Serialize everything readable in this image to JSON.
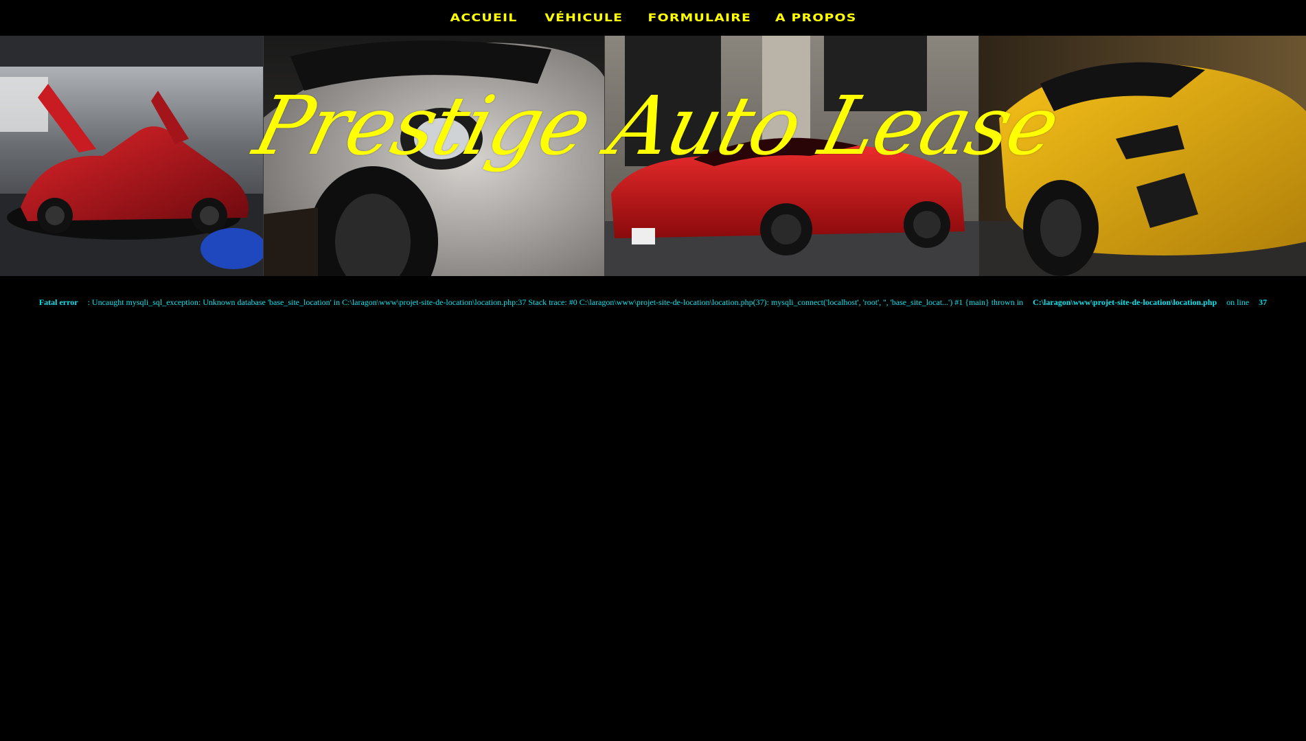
{
  "nav": {
    "items": [
      {
        "label": "ACCUEIL"
      },
      {
        "label": "VÉHICULE"
      },
      {
        "label": "FORMULAIRE"
      },
      {
        "label": "A PROPOS"
      }
    ]
  },
  "banner": {
    "title": "Prestige Auto Lease",
    "photos": [
      {
        "description": "red-supercar-doors-open"
      },
      {
        "description": "white-sports-car-closeup"
      },
      {
        "description": "red-grand-tourer-street"
      },
      {
        "description": "yellow-supercar-front"
      }
    ]
  },
  "error": {
    "label": "Fatal error",
    "message": ": Uncaught mysqli_sql_exception: Unknown database 'base_site_location' in C:\\laragon\\www\\projet-site-de-location\\location.php:37 Stack trace: #0 C:\\laragon\\www\\projet-site-de-location\\location.php(37): mysqli_connect('localhost', 'root', '', 'base_site_locat...') #1 {main} thrown in",
    "file": "C:\\laragon\\www\\projet-site-de-location\\location.php",
    "on_line_text": "on line",
    "line_number": "37"
  },
  "colors": {
    "nav_text": "#ffff00",
    "title": "#ffff00",
    "error_text": "#00e5ee",
    "background": "#000000"
  }
}
